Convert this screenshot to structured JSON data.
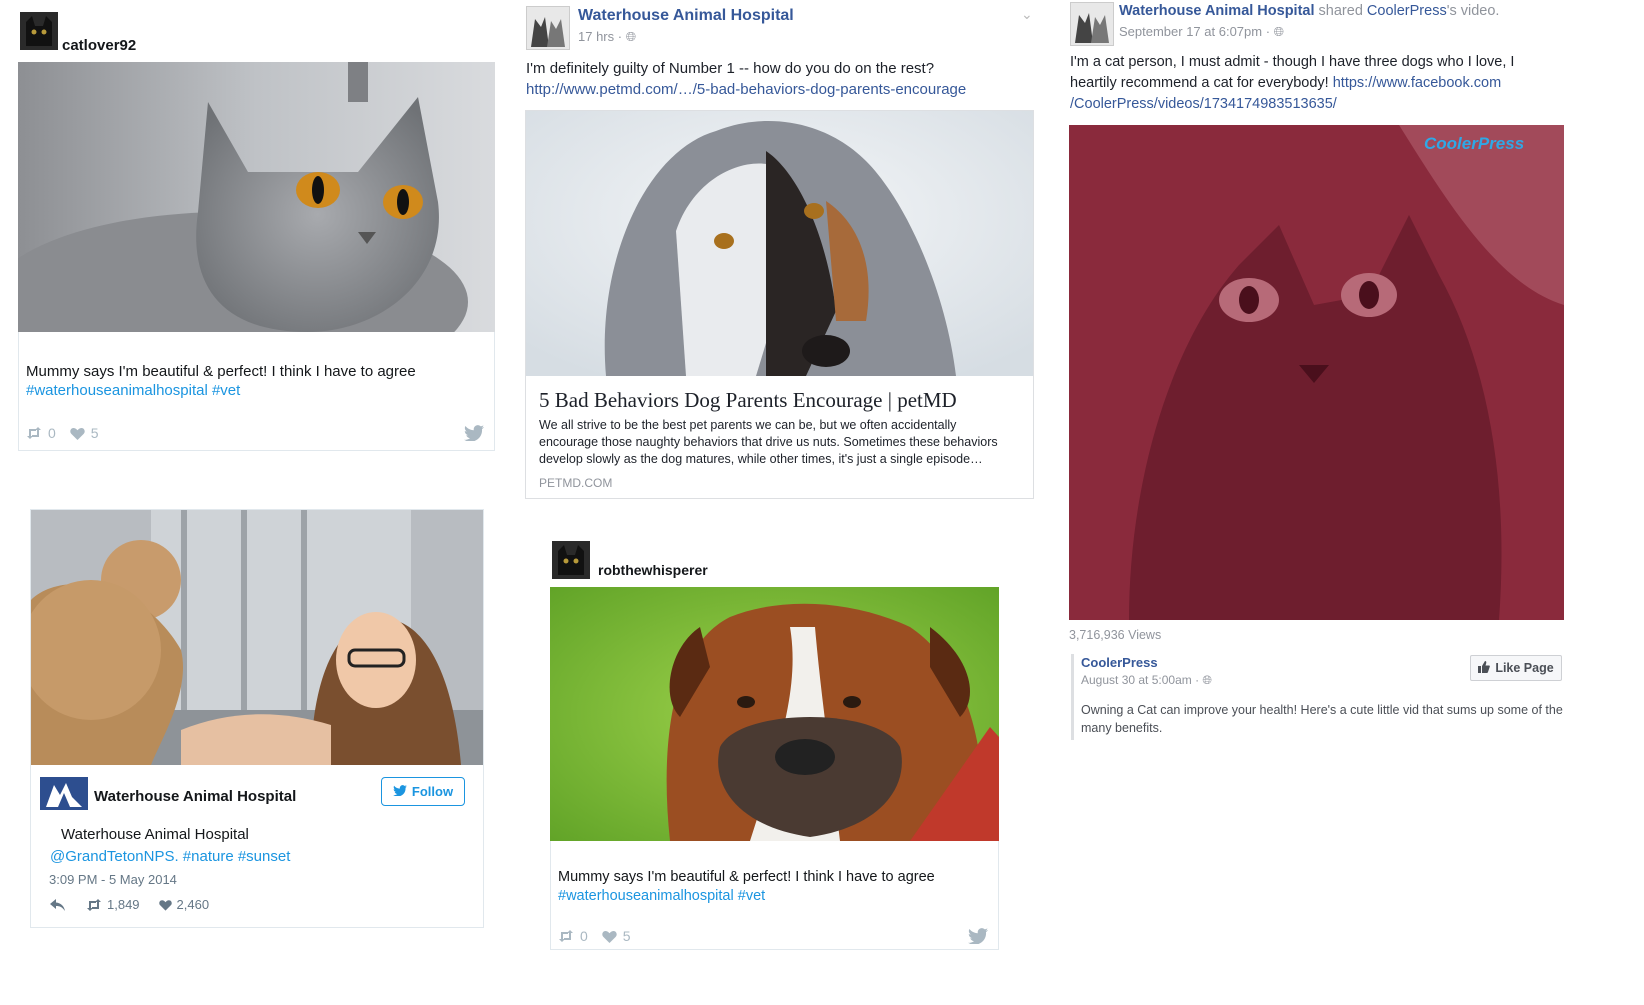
{
  "post1": {
    "username": "catlover92",
    "caption": "Mummy says I'm beautiful & perfect! I think I have to agree",
    "hashtags": "#waterhouseanimalhospital #vet",
    "retweets": "0",
    "likes": "5",
    "icons": [
      "retweet-icon",
      "heart-icon",
      "twitter-bird-icon"
    ]
  },
  "post2": {
    "page_name": "Waterhouse Animal Hospital",
    "time": "17 hrs ·",
    "text": "I'm definitely guilty of Number 1 -- how do you do on the rest?",
    "link": "http://www.petmd.com/…/5-bad-behaviors-dog-parents-encourage",
    "link_card": {
      "title": "5 Bad Behaviors Dog Parents Encourage | petMD",
      "description": "We all strive to be the best pet parents we can be, but we often accidentally encourage those naughty behaviors that drive us nuts. Sometimes these behaviors develop slowly as the dog matures, while other times, it's just a single episode…",
      "domain": "PETMD.COM"
    }
  },
  "post3": {
    "page_name": "Waterhouse Animal Hospital",
    "action": "shared",
    "source": "CoolerPress",
    "suffix": "'s video.",
    "time": "September 17 at 6:07pm ·",
    "text_before_link": "I'm a cat person, I must admit - though I have three dogs who I love, I heartily recommend a cat for everybody!",
    "link_line1": "https://www.facebook.com",
    "link_line2": "/CoolerPress/videos/1734174983513635/",
    "video_watermark": "CoolerPress",
    "views": "3,716,936 Views",
    "shared_page": "CoolerPress",
    "shared_time": "August 30 at 5:00am ·",
    "like_page_label": "Like Page",
    "shared_text": "Owning a Cat can improve your health! Here's a cute little vid that sums up some of the many benefits."
  },
  "post4": {
    "account_name": "Waterhouse Animal Hospital",
    "follow_label": "Follow",
    "tweet_author": "Waterhouse Animal Hospital",
    "mention": "@GrandTetonNPS.",
    "hashtags": "#nature #sunset",
    "timestamp": "3:09 PM - 5 May 2014",
    "retweets": "1,849",
    "likes": "2,460"
  },
  "post5": {
    "username": "robthewhisperer",
    "caption": "Mummy says I'm beautiful & perfect! I think I have to agree",
    "hashtags": "#waterhouseanimalhospital #vet",
    "retweets": "0",
    "likes": "5"
  },
  "colors": {
    "link_blue": "#365899",
    "twitter_blue": "#1b95e0",
    "meta_grey": "#90949c",
    "video_tint": "#8a2a3c",
    "border": "#e1e8ed"
  }
}
